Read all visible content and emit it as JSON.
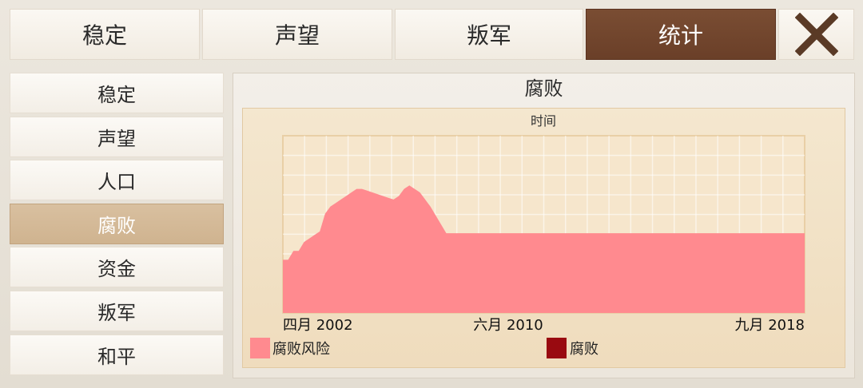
{
  "tabs": [
    {
      "label": "稳定",
      "active": false
    },
    {
      "label": "声望",
      "active": false
    },
    {
      "label": "叛军",
      "active": false
    },
    {
      "label": "统计",
      "active": true
    }
  ],
  "sidebar": {
    "items": [
      {
        "label": "稳定",
        "active": false
      },
      {
        "label": "声望",
        "active": false
      },
      {
        "label": "人口",
        "active": false
      },
      {
        "label": "腐败",
        "active": true
      },
      {
        "label": "资金",
        "active": false
      },
      {
        "label": "叛军",
        "active": false
      },
      {
        "label": "和平",
        "active": false
      }
    ]
  },
  "panel": {
    "title": "腐败"
  },
  "colors": {
    "tab_active": "#6f432b",
    "sidebar_active": "#d4b895",
    "risk_series": "#ff8a8f",
    "corruption_series": "#990a10",
    "close_icon": "#5a3a26"
  },
  "chart_data": {
    "type": "area",
    "title": "",
    "xlabel": "时间",
    "ylabel": "",
    "x_tick_labels": [
      "四月 2002",
      "六月 2010",
      "九月 2018"
    ],
    "ylim": [
      0,
      100
    ],
    "grid": true,
    "legend_position": "bottom",
    "series": [
      {
        "name": "腐败风险",
        "color": "#ff8a8f",
        "values": [
          30,
          30,
          35,
          35,
          40,
          42,
          44,
          46,
          56,
          60,
          62,
          64,
          66,
          68,
          70,
          70,
          69,
          68,
          67,
          66,
          65,
          64,
          66,
          70,
          72,
          70,
          68,
          64,
          60,
          55,
          50,
          45,
          45,
          45,
          45,
          45,
          45,
          45,
          45,
          45,
          45,
          45,
          45,
          45,
          45,
          45,
          45,
          45,
          45,
          45,
          45,
          45,
          45,
          45,
          45,
          45,
          45,
          45,
          45,
          45,
          45,
          45,
          45,
          45,
          45,
          45,
          45,
          45,
          45,
          45,
          45,
          45,
          45,
          45,
          45,
          45,
          45,
          45,
          45,
          45,
          45,
          45,
          45,
          45,
          45,
          45,
          45,
          45,
          45,
          45,
          45,
          45,
          45,
          45,
          45,
          45,
          45,
          45,
          45,
          45
        ]
      }
    ]
  },
  "chart_legend": {
    "risk_label": "腐败风险",
    "corruption_label": "腐败"
  }
}
